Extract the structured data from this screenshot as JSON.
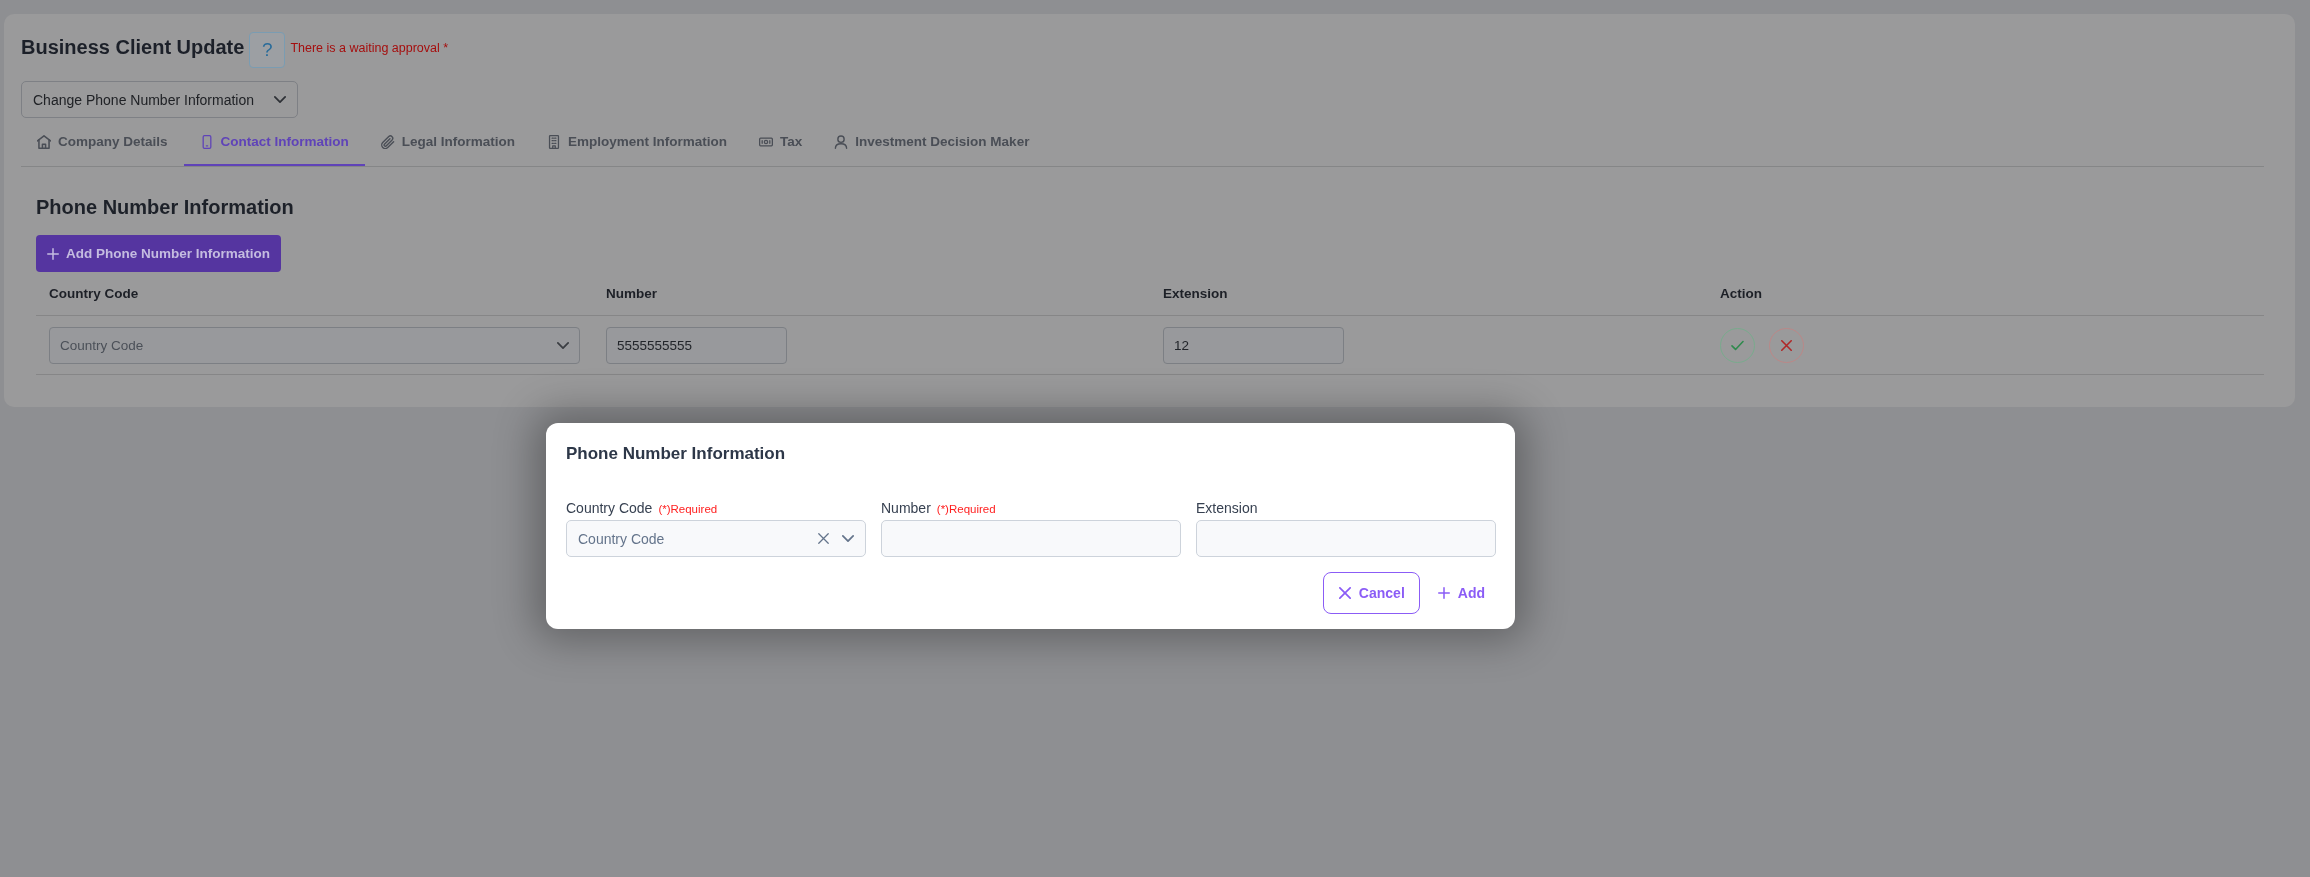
{
  "page": {
    "title": "Business Client Update",
    "help_button": "?",
    "notice": "There is a waiting approval *"
  },
  "request_type": {
    "value": "Change Phone Number Information"
  },
  "tabs": [
    {
      "label": "Company Details",
      "kind": "company",
      "selected": false
    },
    {
      "label": "Contact Information",
      "kind": "contact",
      "selected": true
    },
    {
      "label": "Legal Information",
      "kind": "legal",
      "selected": false
    },
    {
      "label": "Employment Information",
      "kind": "employment",
      "selected": false
    },
    {
      "label": "Tax",
      "kind": "tax",
      "selected": false
    },
    {
      "label": "Investment Decision Maker",
      "kind": "decision_maker",
      "selected": false
    }
  ],
  "section": {
    "title": "Phone Number Information",
    "add_button": "Add Phone Number Information"
  },
  "table": {
    "columns": [
      "Country Code",
      "Number",
      "Extension",
      "Action"
    ],
    "rows": [
      {
        "country_code": {
          "placeholder": "Country Code"
        },
        "number": {
          "value": "5555555555"
        },
        "extension": {
          "value": "12"
        }
      }
    ]
  },
  "dialog": {
    "title": "Phone Number Information",
    "fields": [
      {
        "label": "Country Code",
        "required_note": "(*)Required",
        "kind": "select",
        "placeholder": "Country Code"
      },
      {
        "label": "Number",
        "required_note": "(*)Required",
        "kind": "text"
      },
      {
        "label": "Extension",
        "kind": "text"
      }
    ],
    "buttons": [
      {
        "label": "Cancel",
        "kind": "cancel"
      },
      {
        "label": "Add",
        "kind": "add"
      }
    ]
  }
}
